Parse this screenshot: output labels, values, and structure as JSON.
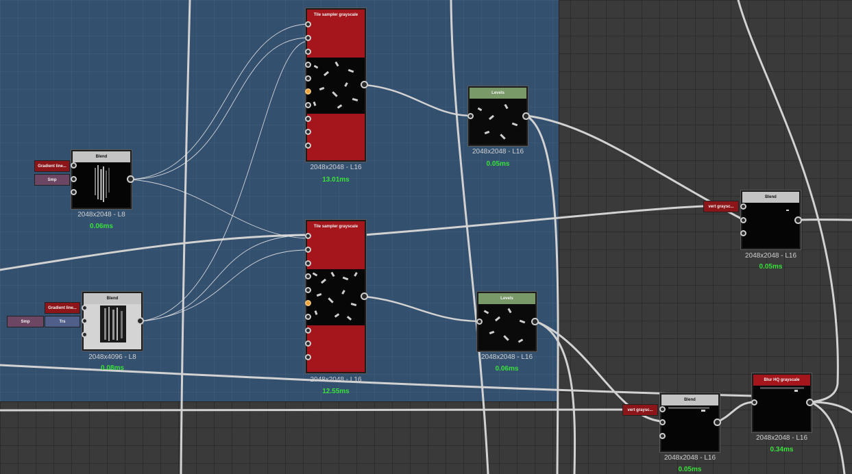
{
  "nodes": {
    "blend1": {
      "title": "Blend",
      "size": "2048x2048 - L8",
      "time": "0.06ms",
      "input1": "Gradient line...",
      "input2": "Smp"
    },
    "tile1": {
      "title": "Tile sampler grayscale",
      "size": "2048x2048 - L16",
      "time": "13.01ms"
    },
    "levels1": {
      "title": "Levels",
      "size": "2048x2048 - L16",
      "time": "0.05ms"
    },
    "blend2": {
      "title": "Blend",
      "size": "2048x4096 - L8",
      "time": "0.08ms",
      "input1": "Gradient line...",
      "input2": "Smp",
      "input3": "Trs"
    },
    "tile2": {
      "title": "Tile sampler grayscale",
      "size": "2048x2048 - L16",
      "time": "12.55ms"
    },
    "levels2": {
      "title": "Levels",
      "size": "2048x2048 - L16",
      "time": "0.06ms"
    },
    "blend3": {
      "title": "Blend",
      "size": "2048x2048 - L16",
      "time": "0.05ms",
      "input1": "vert graysc..."
    },
    "blend4": {
      "title": "Blend",
      "size": "2048x2048 - L16",
      "time": "0.05ms",
      "input1": "vert graysc..."
    },
    "blur": {
      "title": "Blur HQ grayscale",
      "size": "2048x2048 - L16",
      "time": "0.34ms"
    }
  },
  "colors": {
    "frame_bg": "#34506f",
    "canvas_bg": "#3a3a3a",
    "red_header": "#a5161c",
    "green_header": "#7a9968",
    "gray_header": "#c4c4c4",
    "time_text": "#39e03b",
    "wire": "#d6d6d6"
  }
}
